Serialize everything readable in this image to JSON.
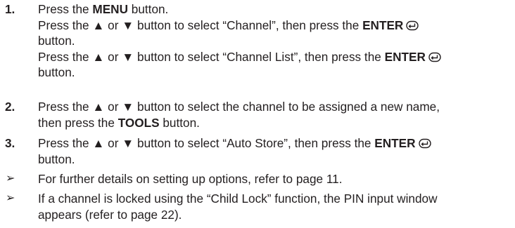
{
  "steps": [
    {
      "number": "1.",
      "lines": [
        {
          "pre": "Press the ",
          "bold": "MENU",
          "post": " button."
        },
        {
          "pre": "Press the ▲ or ▼ button to select “Channel”, then press the ",
          "bold": "ENTER",
          "icon": "enter-icon"
        },
        {
          "pre": "button."
        },
        {
          "pre": "Press the ▲ or ▼ button to select “Channel List”, then press the ",
          "bold": "ENTER",
          "icon": "enter-icon"
        },
        {
          "pre": "button."
        }
      ]
    },
    {
      "number": "2.",
      "lines": [
        {
          "pre": "Press the ▲ or ▼ button to select the channel to be assigned a new name,"
        },
        {
          "pre": "then press the ",
          "bold": "TOOLS",
          "post": " button."
        }
      ]
    },
    {
      "number": "3.",
      "lines": [
        {
          "pre": "Press the ▲ or ▼ button to select “Auto Store”, then press the ",
          "bold": "ENTER",
          "icon": "enter-icon"
        },
        {
          "pre": "button."
        }
      ]
    }
  ],
  "notes": [
    {
      "bullet": "➢",
      "lines": [
        {
          "pre": "For further details on setting up options, refer to page 11."
        }
      ]
    },
    {
      "bullet": "➢",
      "lines": [
        {
          "pre": "If a channel is locked using the “Child Lock” function, the PIN input window"
        },
        {
          "pre": "appears (refer to page 22)."
        }
      ]
    }
  ]
}
